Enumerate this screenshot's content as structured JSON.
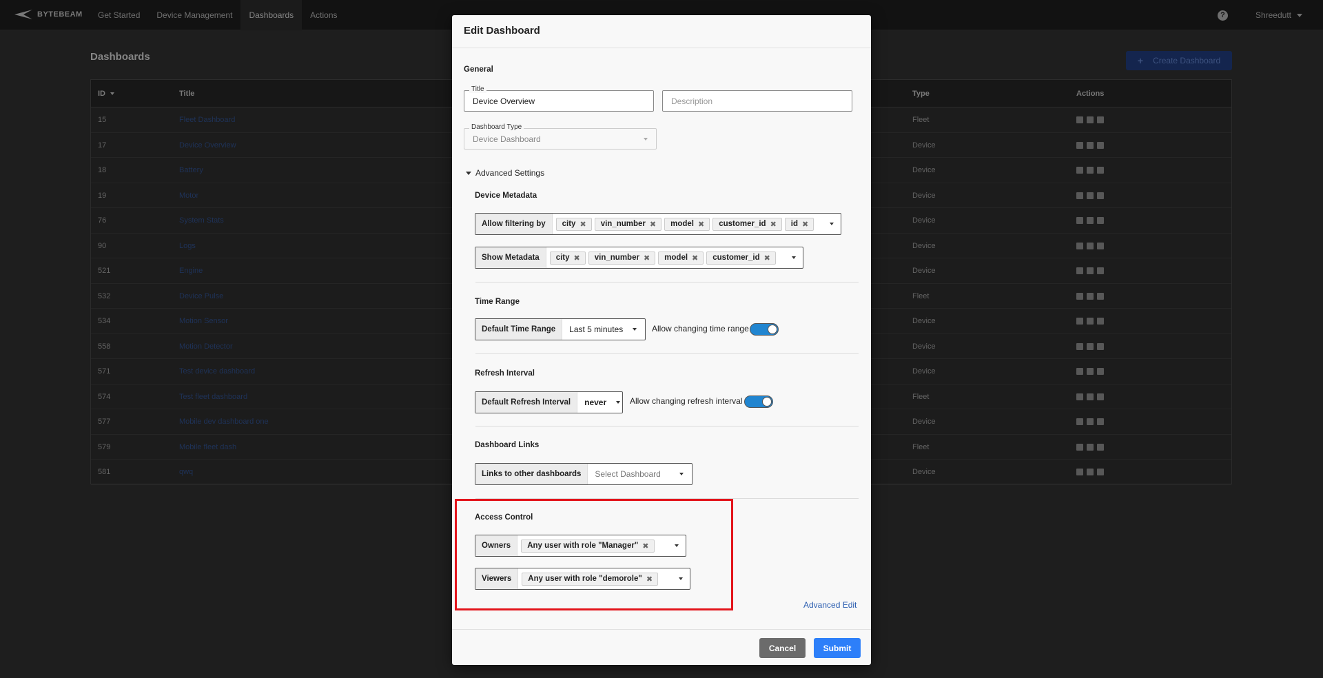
{
  "app": {
    "logo_text": "BYTEBEAM",
    "nav": [
      "Get Started",
      "Device Management",
      "Dashboards",
      "Actions"
    ],
    "active_nav": "Dashboards",
    "user_name": "Shreedutt"
  },
  "page": {
    "title": "Dashboards",
    "create_button": "Create Dashboard",
    "columns": {
      "id": "ID",
      "title": "Title",
      "type": "Type",
      "actions": "Actions"
    },
    "rows": [
      {
        "id": "15",
        "title": "Fleet Dashboard",
        "type": "Fleet"
      },
      {
        "id": "17",
        "title": "Device Overview",
        "type": "Device"
      },
      {
        "id": "18",
        "title": "Battery",
        "type": "Device"
      },
      {
        "id": "19",
        "title": "Motor",
        "type": "Device"
      },
      {
        "id": "76",
        "title": "System Stats",
        "type": "Device"
      },
      {
        "id": "90",
        "title": "Logs",
        "type": "Device"
      },
      {
        "id": "521",
        "title": "Engine",
        "type": "Device"
      },
      {
        "id": "532",
        "title": "Device Pulse",
        "type": "Fleet"
      },
      {
        "id": "534",
        "title": "Motion Sensor",
        "type": "Device"
      },
      {
        "id": "558",
        "title": "Motion Detector",
        "type": "Device"
      },
      {
        "id": "571",
        "title": "Test device dashboard",
        "type": "Device"
      },
      {
        "id": "574",
        "title": "Test fleet dashboard",
        "type": "Fleet"
      },
      {
        "id": "577",
        "title": "Mobile dev dashboard one",
        "type": "Device"
      },
      {
        "id": "579",
        "title": "Mobile fleet dash",
        "type": "Fleet"
      },
      {
        "id": "581",
        "title": "qwq",
        "type": "Device"
      }
    ]
  },
  "modal": {
    "title": "Edit Dashboard",
    "general": {
      "heading": "General",
      "title_label": "Title",
      "title_value": "Device Overview",
      "description_placeholder": "Description",
      "type_label": "Dashboard Type",
      "type_value": "Device Dashboard"
    },
    "advanced_settings_label": "Advanced Settings",
    "device_metadata": {
      "heading": "Device Metadata",
      "filter_label": "Allow filtering by",
      "filter_tags": [
        "city",
        "vin_number",
        "model",
        "customer_id",
        "id"
      ],
      "show_label": "Show Metadata",
      "show_tags": [
        "city",
        "vin_number",
        "model",
        "customer_id"
      ]
    },
    "time_range": {
      "heading": "Time Range",
      "label": "Default Time Range",
      "value": "Last 5 minutes",
      "toggle_label": "Allow changing time range",
      "toggle_on": true
    },
    "refresh_interval": {
      "heading": "Refresh Interval",
      "label": "Default Refresh Interval",
      "value": "never",
      "toggle_label": "Allow changing refresh interval",
      "toggle_on": true
    },
    "dashboard_links": {
      "heading": "Dashboard Links",
      "label": "Links to other dashboards",
      "placeholder": "Select Dashboard"
    },
    "access_control": {
      "heading": "Access Control",
      "owners_label": "Owners",
      "owners_tag": "Any user with role \"Manager\"",
      "viewers_label": "Viewers",
      "viewers_tag": "Any user with role \"demorole\""
    },
    "advanced_edit": "Advanced Edit",
    "cancel": "Cancel",
    "submit": "Submit"
  },
  "colors": {
    "highlight": "#e3141b",
    "primary": "#2d7ff9",
    "toggle": "#2185d0"
  }
}
